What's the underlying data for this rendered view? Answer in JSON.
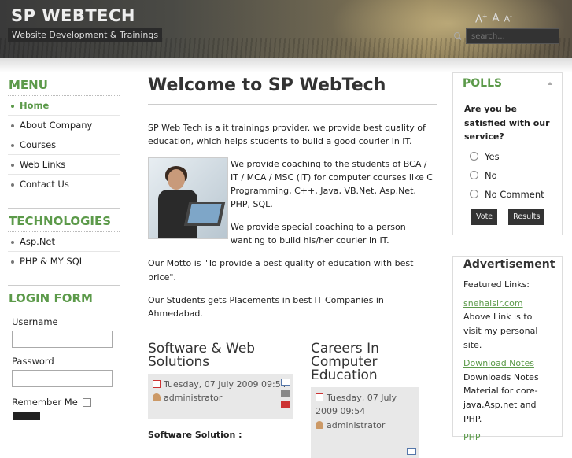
{
  "header": {
    "title": "SP WEBTECH",
    "tagline": "Website Development & Trainings",
    "font_tools": {
      "increase": "A",
      "reset": "A",
      "decrease": "A"
    },
    "search": {
      "placeholder": "search..."
    }
  },
  "left": {
    "menu_title": "MENU",
    "menu": [
      "Home",
      "About Company",
      "Courses",
      "Web Links",
      "Contact Us"
    ],
    "tech_title": "TECHNOLOGIES",
    "tech": [
      "Asp.Net",
      "PHP & MY SQL"
    ],
    "login_title": "LOGIN FORM",
    "login": {
      "username_label": "Username",
      "password_label": "Password",
      "remember_label": "Remember Me"
    }
  },
  "main": {
    "title": "Welcome to SP WebTech",
    "intro": "SP Web Tech is a it trainings provider. we provide best quality of education, which helps students to build a good courier in IT.",
    "p2": "We provide coaching to the students of BCA / IT / MCA / MSC (IT) for computer courses like C Programming, C++, Java, VB.Net, Asp.Net, PHP, SQL.",
    "p3": "We provide special coaching to a person wanting to build his/her courier in IT.",
    "p4": "Our Motto is \"To provide a best quality of education with best price\".",
    "p5": "Our Students gets Placements in best IT Companies in Ahmedabad.",
    "articles": [
      {
        "title": "Software & Web Solutions",
        "date": "Tuesday, 07 July 2009 09:54",
        "author": "administrator",
        "subhead": "Software Solution :"
      },
      {
        "title": "Careers In Computer Education",
        "date": "Tuesday, 07 July 2009 09:54",
        "author": "administrator"
      }
    ]
  },
  "right": {
    "polls_title": "POLLS",
    "question": "Are you be satisfied with our service?",
    "options": [
      "Yes",
      "No",
      "No Comment"
    ],
    "vote": "Vote",
    "results": "Results",
    "adv_title": "Advertisement",
    "featured": "Featured Links:",
    "link1": "snehalsir.com",
    "link1_desc": "Above Link is to visit my personal site.",
    "link2": "Download Notes",
    "link2_desc": "Downloads Notes Material for core-java,Asp.net and PHP.",
    "link3": "PHP"
  }
}
